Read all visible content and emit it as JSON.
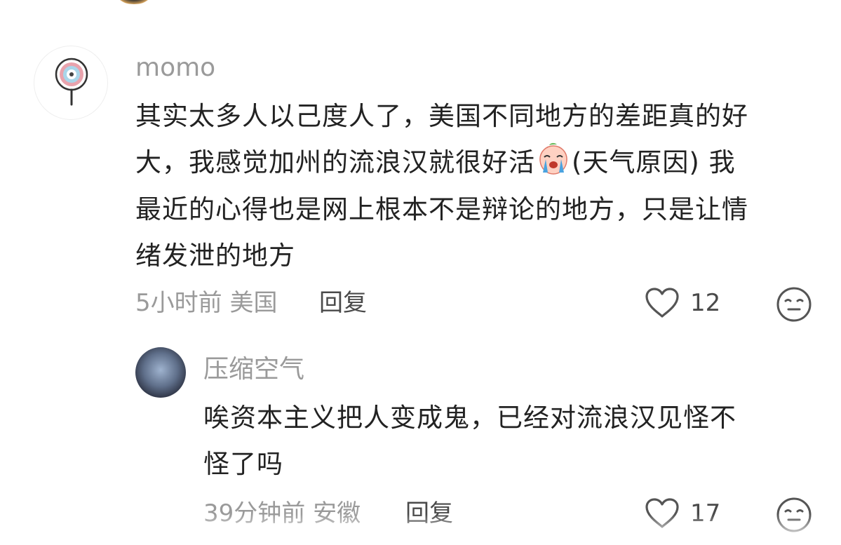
{
  "comment1": {
    "username": "momo",
    "text_line1": "其实太多人以己度人了，美国不同地方的差距真的好",
    "text_line2_a": "大，我感觉加州的流浪汉就很好活",
    "text_line2_b": "(天气原因) 我",
    "text_line3": "最近的心得也是网上根本不是辩论的地方，只是让情",
    "text_line4": "绪发泄的地方",
    "time": "5小时前",
    "location": "美国",
    "reply_label": "回复",
    "like_count": "12"
  },
  "comment2": {
    "username": "压缩空气",
    "text_line1": "唉资本主义把人变成鬼，已经对流浪汉见怪不",
    "text_line2": "怪了吗",
    "time": "39分钟前",
    "location": "安徽",
    "reply_label": "回复",
    "like_count": "17"
  },
  "colors": {
    "username": "#9a9a9a",
    "text": "#222222",
    "meta": "#9a9a9a",
    "icon": "#555555"
  }
}
